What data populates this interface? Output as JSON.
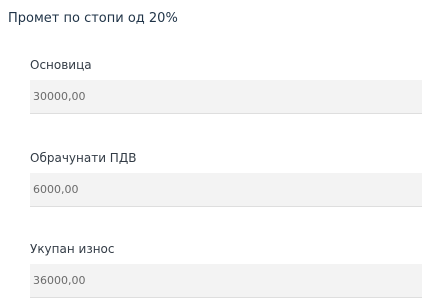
{
  "section": {
    "title": "Промет по стопи од 20%"
  },
  "fields": [
    {
      "label": "Основица",
      "value": "30000,00"
    },
    {
      "label": "Обрачунати ПДВ",
      "value": "6000,00"
    },
    {
      "label": "Укупан износ",
      "value": "36000,00"
    }
  ]
}
